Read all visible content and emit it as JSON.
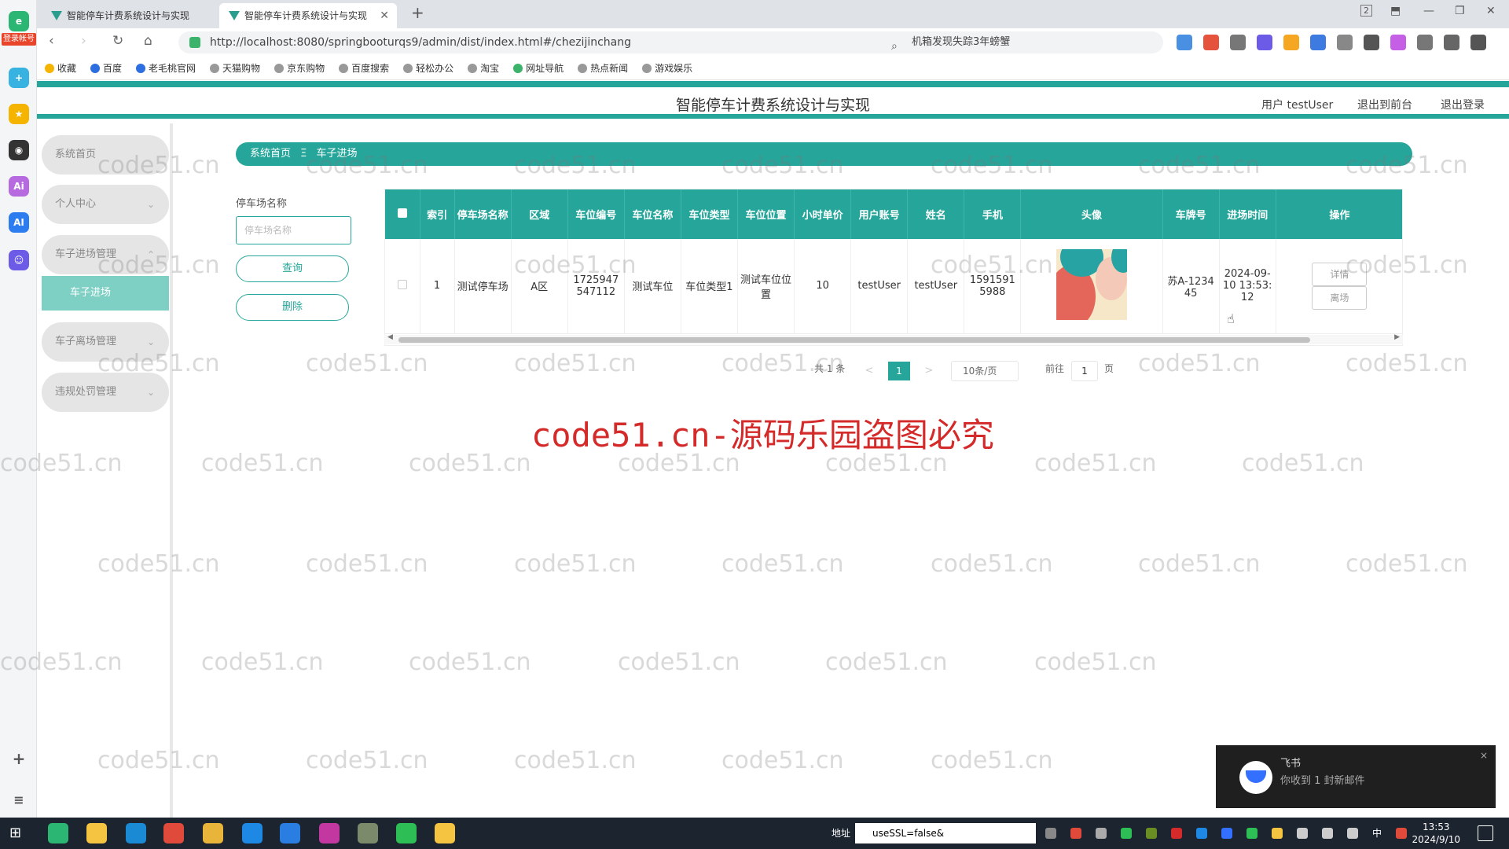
{
  "browser": {
    "tabs": [
      {
        "label": "智能停车计费系统设计与实现"
      },
      {
        "label": "智能停车计费系统设计与实现"
      }
    ],
    "url": "http://localhost:8080/springbooturqs9/admin/dist/index.html#/chezijinchang",
    "search_text": "机箱发现失踪3年螃蟹",
    "login_badge": "登录帐号",
    "tab_count": "2",
    "bookmarks": [
      "收藏",
      "百度",
      "老毛桃官网",
      "天猫购物",
      "京东购物",
      "百度搜索",
      "轻松办公",
      "淘宝",
      "网址导航",
      "热点新闻",
      "游戏娱乐"
    ]
  },
  "app": {
    "title": "智能停车计费系统设计与实现",
    "user_label": "用户 testUser",
    "front_link": "退出到前台",
    "logout_link": "退出登录"
  },
  "sidebar": {
    "items": [
      {
        "label": "系统首页"
      },
      {
        "label": "个人中心"
      },
      {
        "label": "车子进场管理"
      },
      {
        "label": "车子进场"
      },
      {
        "label": "车子离场管理"
      },
      {
        "label": "违规处罚管理"
      }
    ]
  },
  "breadcrumb": {
    "home": "系统首页",
    "sep": "Ξ",
    "current": "车子进场"
  },
  "filter": {
    "label": "停车场名称",
    "placeholder": "停车场名称",
    "query_button": "查询",
    "delete_button": "删除"
  },
  "table": {
    "headers": [
      "索引",
      "停车场名称",
      "区域",
      "车位编号",
      "车位名称",
      "车位类型",
      "车位位置",
      "小时单价",
      "用户账号",
      "姓名",
      "手机",
      "头像",
      "车牌号",
      "进场时间",
      "操作"
    ],
    "rows": [
      {
        "index": "1",
        "lot_name": "测试停车场",
        "area": "A区",
        "space_no": "1725947547112",
        "space_name": "测试车位",
        "space_type": "车位类型1",
        "space_location": "测试车位位置",
        "hour_price": "10",
        "account": "testUser",
        "name": "testUser",
        "phone": "15915915988",
        "plate": "苏A-123445",
        "enter_time": "2024-09-10 13:53:12",
        "detail_button": "详情",
        "leave_button": "离场"
      }
    ]
  },
  "pagination": {
    "total": "共 1 条",
    "prev": "<",
    "current_page": "1",
    "next": ">",
    "page_size": "10条/页",
    "goto_label": "前往",
    "goto_value": "1",
    "page_unit": "页"
  },
  "watermark": {
    "text": "code51.cn",
    "notice": "code51.cn-源码乐园盗图必究"
  },
  "notification": {
    "app": "飞书",
    "message": "你收到 1 封新邮件",
    "close": "×"
  },
  "taskbar": {
    "address_label": "地址",
    "address_value": "useSSL=false&",
    "time": "13:53",
    "date": "2024/9/10",
    "ime": "中"
  },
  "colors": {
    "accent": "#26a69a",
    "accent_light": "#7fd0c4",
    "watermark_red": "#d42a2a"
  }
}
